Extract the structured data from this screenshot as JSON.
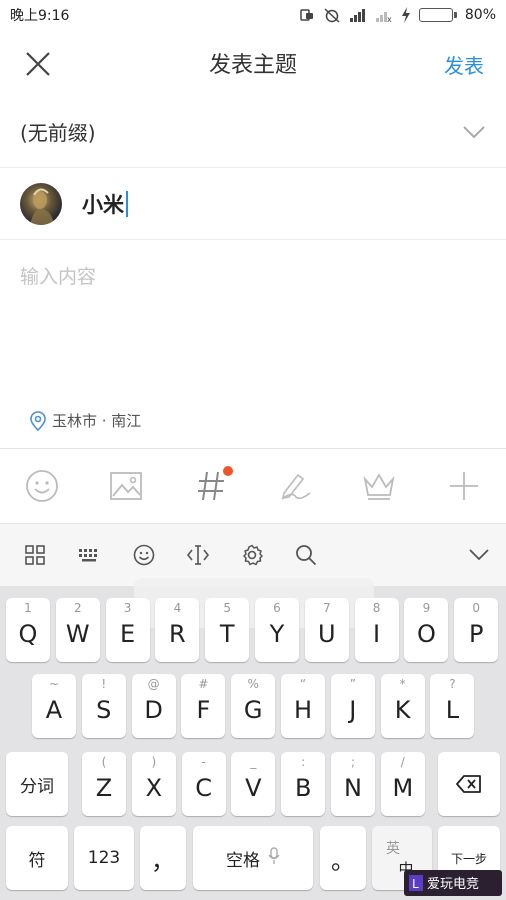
{
  "status_bar": {
    "time": "晚上9:16",
    "battery_percent": "80%",
    "battery_level": 0.8
  },
  "header": {
    "title": "发表主题",
    "publish_label": "发表"
  },
  "form": {
    "prefix_label": "(无前缀)",
    "user_name": "小米",
    "content_placeholder": "输入内容",
    "location": "玉林市 · 南江"
  },
  "toolbar": {
    "icons": [
      "emoji-icon",
      "image-icon",
      "hashtag-icon",
      "pen-icon",
      "crown-icon",
      "plus-icon"
    ]
  },
  "keyboard": {
    "row1": [
      {
        "hint": "1",
        "key": "Q"
      },
      {
        "hint": "2",
        "key": "W"
      },
      {
        "hint": "3",
        "key": "E"
      },
      {
        "hint": "4",
        "key": "R"
      },
      {
        "hint": "5",
        "key": "T"
      },
      {
        "hint": "6",
        "key": "Y"
      },
      {
        "hint": "7",
        "key": "U"
      },
      {
        "hint": "8",
        "key": "I"
      },
      {
        "hint": "9",
        "key": "O"
      },
      {
        "hint": "0",
        "key": "P"
      }
    ],
    "row2": [
      {
        "hint": "~",
        "key": "A"
      },
      {
        "hint": "!",
        "key": "S"
      },
      {
        "hint": "@",
        "key": "D"
      },
      {
        "hint": "#",
        "key": "F"
      },
      {
        "hint": "%",
        "key": "G"
      },
      {
        "hint": "“",
        "key": "H"
      },
      {
        "hint": "”",
        "key": "J"
      },
      {
        "hint": "*",
        "key": "K"
      },
      {
        "hint": "?",
        "key": "L"
      }
    ],
    "row3": [
      {
        "hint": "(",
        "key": "Z"
      },
      {
        "hint": ")",
        "key": "X"
      },
      {
        "hint": "-",
        "key": "C"
      },
      {
        "hint": "_",
        "key": "V"
      },
      {
        "hint": ":",
        "key": "B"
      },
      {
        "hint": ";",
        "key": "N"
      },
      {
        "hint": "/",
        "key": "M"
      }
    ],
    "fenci": "分词",
    "fu": "符",
    "num": "123",
    "comma": "，",
    "space": "空格",
    "period": "。",
    "lang_top": "英",
    "lang_bottom": "中",
    "next": "下一步"
  },
  "watermark": {
    "text": "爱玩电竞"
  },
  "colors": {
    "accent": "#2b8fe0",
    "notify_dot": "#f0552a",
    "battery": "#2fc744"
  }
}
